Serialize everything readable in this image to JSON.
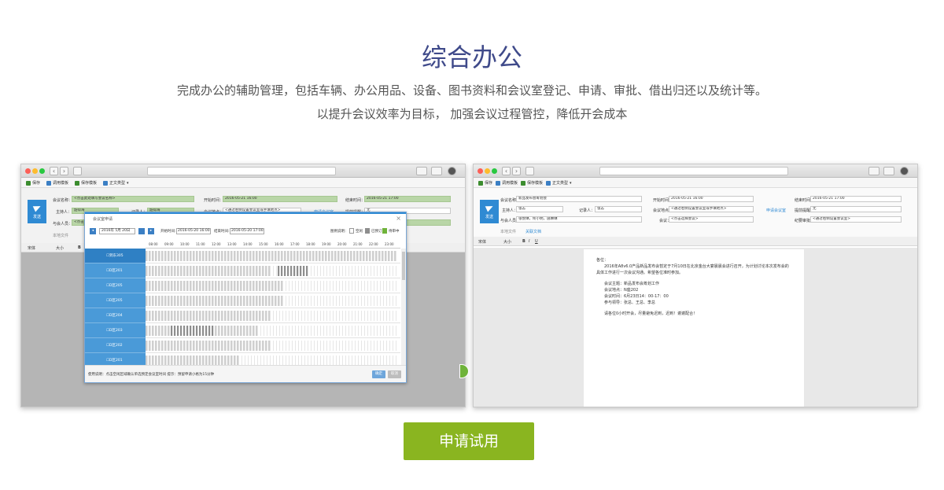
{
  "header": {
    "title": "综合办公",
    "subtitle_line1": "完成办公的辅助管理，包括车辆、办公用品、设备、图书资料和会议室登记、申请、审批、借出归还以及统计等。",
    "subtitle_line2": "以提升会议效率为目标，  加强会议过程管控，降低开会成本"
  },
  "left_screenshot": {
    "toolbar": {
      "save": "保存",
      "template": "调用模板",
      "save_template": "保存模板",
      "doc_type": "正文类型"
    },
    "send_label": "发送",
    "fields": {
      "meeting_name_label": "会议名称：",
      "meeting_name_value": "<点击此处填写会议名称>",
      "start_time_label": "开始时间：",
      "start_time_value": "2016-05-21 16:00",
      "end_time_label": "结束时间：",
      "end_time_value": "2016-05-21 17:00",
      "host_label": "主持人：",
      "host_value": "韶得海",
      "recorder_label": "记录人：",
      "recorder_value": "韶得海",
      "place_label": "会议地点：",
      "place_value": "<通过右侧设置会议室或手填地点>",
      "request_room": "申请会议室",
      "remind_label": "提前提醒：",
      "remind_value": "无",
      "attendees_label": "与会人员：",
      "attendees_value": "<点击选择>",
      "attachment": "本地文件"
    },
    "editor": {
      "font": "宋体",
      "size": "大小"
    },
    "dialog": {
      "title": "会议室申请",
      "date_value": "2016年 5月 20日",
      "start_label": "开始时间:",
      "start_value": "2016-05-20 16:00",
      "end_label": "结束时间:",
      "end_value": "2016-05-20 17:00",
      "legend_label": "图例说明：",
      "legend_free": "空闲",
      "legend_booked": "已预订",
      "legend_pending": "待审中",
      "rooms": [
        "到东305",
        "D区201",
        "D区205",
        "D区205",
        "D区204",
        "D区203",
        "D区202",
        "D区201"
      ],
      "hours": [
        "08:00",
        "09:00",
        "10:00",
        "11:00",
        "12:00",
        "13:00",
        "14:00",
        "15:00",
        "16:00",
        "17:00",
        "18:00",
        "19:00",
        "20:00",
        "21:00",
        "22:00",
        "23:00"
      ],
      "footer_note": "使用说明：点击空闲区域确认单选预定会议室时间 提示：预留申请小格为15分钟",
      "ok": "确定",
      "cancel": "取消"
    }
  },
  "right_screenshot": {
    "toolbar": {
      "save": "保存",
      "template": "调用模板",
      "save_template": "保存模板",
      "doc_type": "正文类型"
    },
    "send_label": "发送",
    "fields": {
      "meeting_name_label": "会议名称：",
      "meeting_name_value": "新品发布会筹划会",
      "start_time_label": "开始时间：",
      "start_time_value": "2016-05-21 16:00",
      "end_time_label": "结束时间：",
      "end_time_value": "2016-05-21 17:00",
      "host_label": "主持人：",
      "host_value": "张志",
      "recorder_label": "记录人：",
      "recorder_value": "张志",
      "place_label": "会议地点：",
      "place_value": "<通过右侧设置会议室或手填地点>",
      "request_room": "申请会议室",
      "remind_label": "提前提醒：",
      "remind_value": "无",
      "attendees_label": "与会人员：",
      "attendees_value": "张悦琳，佟小明，施琳琳",
      "task_label": "会议：",
      "task_value": "<点击选择会议>",
      "record_label": "纪要审批：",
      "record_value": "<通过右侧设置会议室>",
      "attachment": "本地文件",
      "related": "关联文档"
    },
    "editor": {
      "font": "宋体",
      "size": "大小"
    },
    "doc": {
      "greeting": "各位：",
      "para1": "2016年A8v6.0产品新品发布会暂定于7月10日在北京金台大宴晨晨会进行召开，为计划讨论本次发布会的具体工作进行一次会议沟通。希望各位准时参加。",
      "topic": "会议主题：新品发布会筹划工作",
      "place": "会议地点：N座202",
      "time": "会议时间：6月23日14：00-17：00",
      "people": "参与领导：张总、王总、李总",
      "closing": "请各位0小时开会，尽量避免迟到，迟到！谢谢配合！"
    }
  },
  "cta": {
    "label": "申请试用"
  },
  "colors": {
    "accent_green": "#8ab520",
    "title_blue": "#3f4a8a",
    "app_blue": "#2f8ad3"
  }
}
